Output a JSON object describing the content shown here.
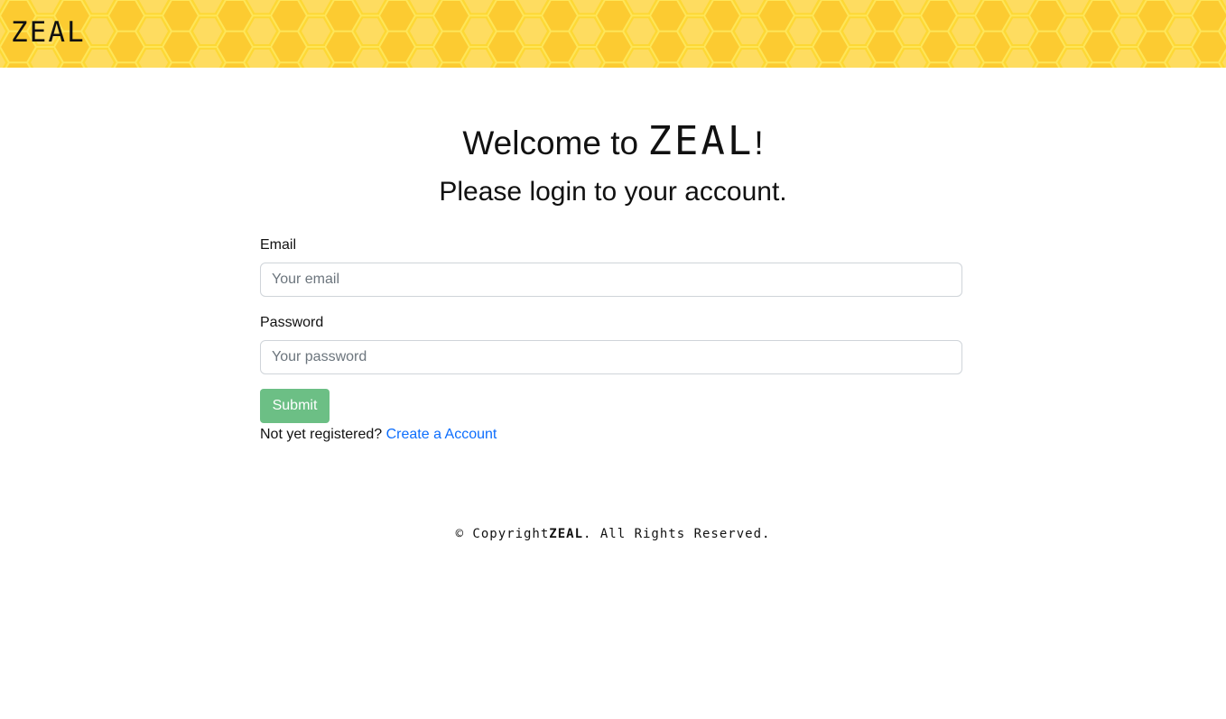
{
  "header": {
    "logo_text": "ZEAL",
    "background_color": "#fdd835"
  },
  "welcome": {
    "prefix": "Welcome to ",
    "brand": "ZEAL",
    "suffix": "!",
    "subtitle": "Please login to your account."
  },
  "form": {
    "email_label": "Email",
    "email_placeholder": "Your email",
    "email_value": "",
    "password_label": "Password",
    "password_placeholder": "Your password",
    "password_value": "",
    "submit_label": "Submit",
    "submit_color": "#6cbf85"
  },
  "register": {
    "prompt": "Not yet registered? ",
    "link_label": "Create a Account",
    "link_color": "#0d6efd"
  },
  "footer": {
    "prefix": "© Copyright",
    "brand": "ZEAL",
    "suffix": ". All Rights Reserved."
  }
}
